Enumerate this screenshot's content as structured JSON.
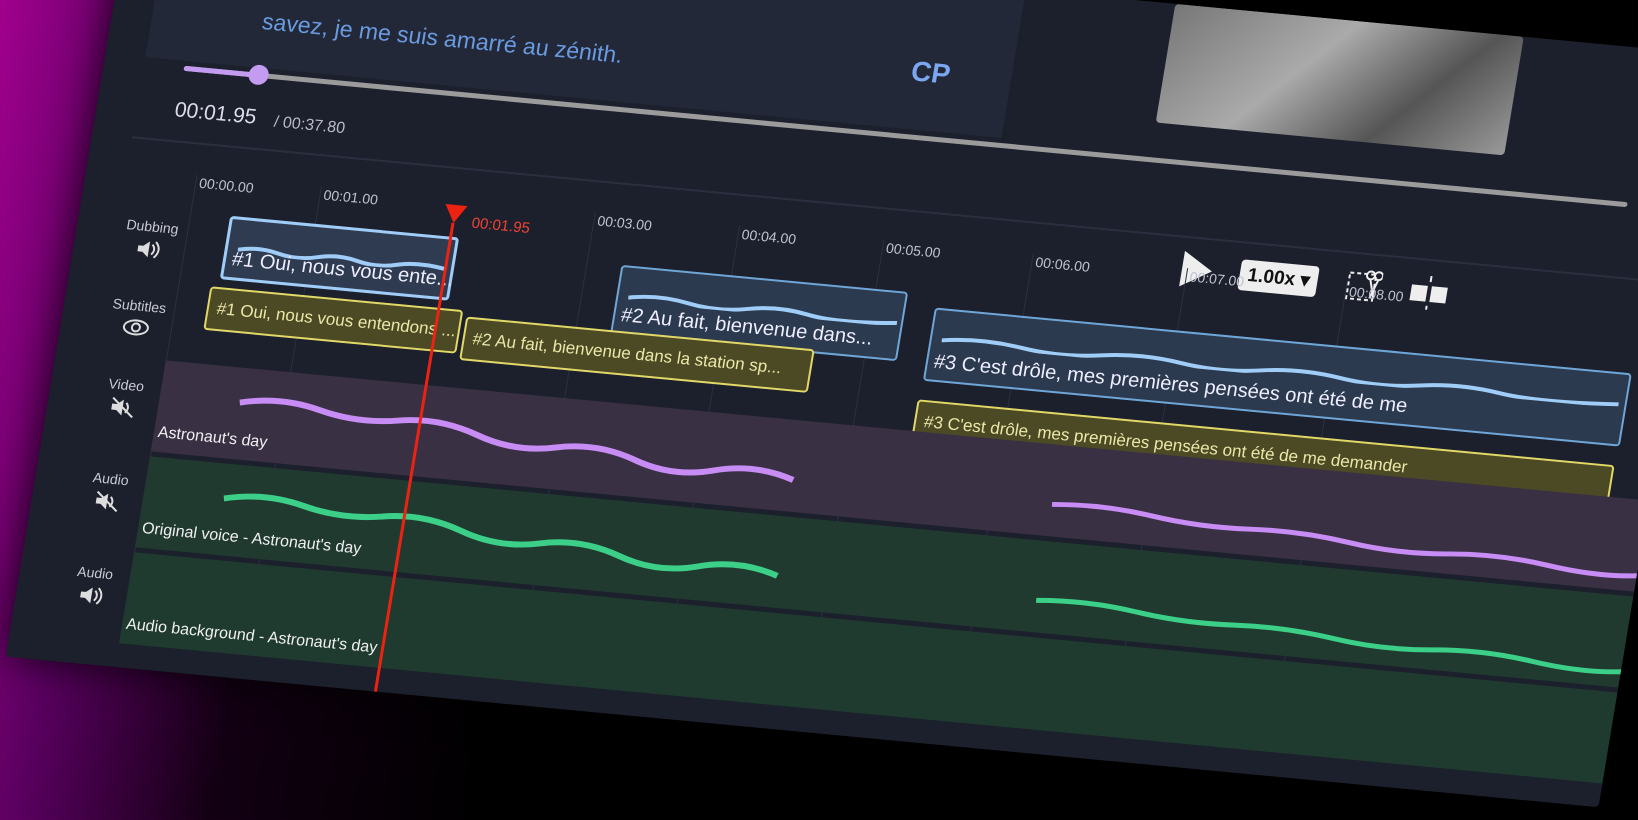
{
  "preview": {
    "subtitle_text": "savez, je me suis amarré au zénith.",
    "cp_label": "CP"
  },
  "player": {
    "current_time": "00:01.95",
    "total_time": "/ 00:37.80",
    "progress_fraction": 0.0516,
    "speed_label": "1.00x"
  },
  "ruler": {
    "ticks": [
      "00:00.00",
      "00:01.00",
      "00:03.00",
      "00:04.00",
      "00:05.00",
      "00:06.00",
      "00:07.00",
      "00:08.00"
    ],
    "playhead_label": "00:01.95"
  },
  "tracks": {
    "dubbing": "Dubbing",
    "subtitles": "Subtitles",
    "video": "Video",
    "audio1": "Audio",
    "audio2": "Audio"
  },
  "dubbing_clips": [
    "#1 Oui, nous vous ente...",
    "#2 Au fait, bienvenue dans...",
    "#3 C'est drôle, mes premières pensées ont été de me"
  ],
  "subtitle_clips": [
    "#1 Oui, nous vous entendons ...",
    "#2 Au fait, bienvenue dans la station sp...",
    "#3 C'est drôle, mes premières pensées ont été de me demander"
  ],
  "lanes": {
    "video": "Astronaut's day",
    "voice": "Original voice - Astronaut's day",
    "background": "Audio background - Astronaut's day"
  },
  "colors": {
    "playhead": "#e21",
    "dub_wave": "#9fcdf7",
    "video_wave": "#c88cf5",
    "voice_wave": "#3ccf88"
  }
}
